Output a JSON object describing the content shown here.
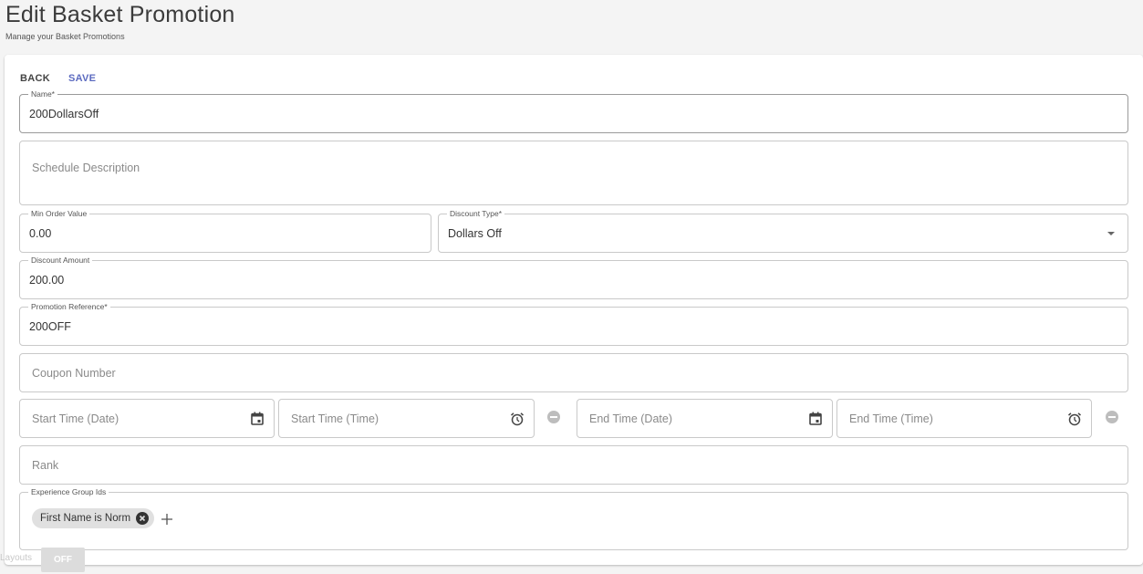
{
  "header": {
    "title": "Edit Basket Promotion",
    "subtitle": "Manage your Basket Promotions"
  },
  "toolbar": {
    "back_label": "BACK",
    "save_label": "SAVE"
  },
  "form": {
    "name": {
      "label": "Name*",
      "value": "200DollarsOff"
    },
    "schedule_description": {
      "placeholder": "Schedule Description"
    },
    "min_order_value": {
      "label": "Min Order Value",
      "value": "0.00"
    },
    "discount_type": {
      "label": "Discount Type*",
      "value": "Dollars Off",
      "icon": "dropdown-arrow-icon"
    },
    "discount_amount": {
      "label": "Discount Amount",
      "value": "200.00"
    },
    "promotion_reference": {
      "label": "Promotion Reference*",
      "value": "200OFF"
    },
    "coupon_number": {
      "placeholder": "Coupon Number"
    },
    "start_date": {
      "placeholder": "Start Time (Date)",
      "icon": "calendar-icon"
    },
    "start_time": {
      "placeholder": "Start Time (Time)",
      "icon": "alarm-clock-icon"
    },
    "end_date": {
      "placeholder": "End Time (Date)",
      "icon": "calendar-icon"
    },
    "end_time": {
      "placeholder": "End Time (Time)",
      "icon": "alarm-clock-icon"
    },
    "rank": {
      "placeholder": "Rank"
    },
    "experience_group_ids": {
      "label": "Experience Group Ids",
      "chips": [
        {
          "label": "First Name is Norm"
        }
      ]
    }
  },
  "footer": {
    "layouts_label": "Layouts",
    "toggle_label": "OFF"
  },
  "colors": {
    "accent": "#5c6bc0",
    "background": "#f4f4f4",
    "chip": "#e0e0e0"
  }
}
